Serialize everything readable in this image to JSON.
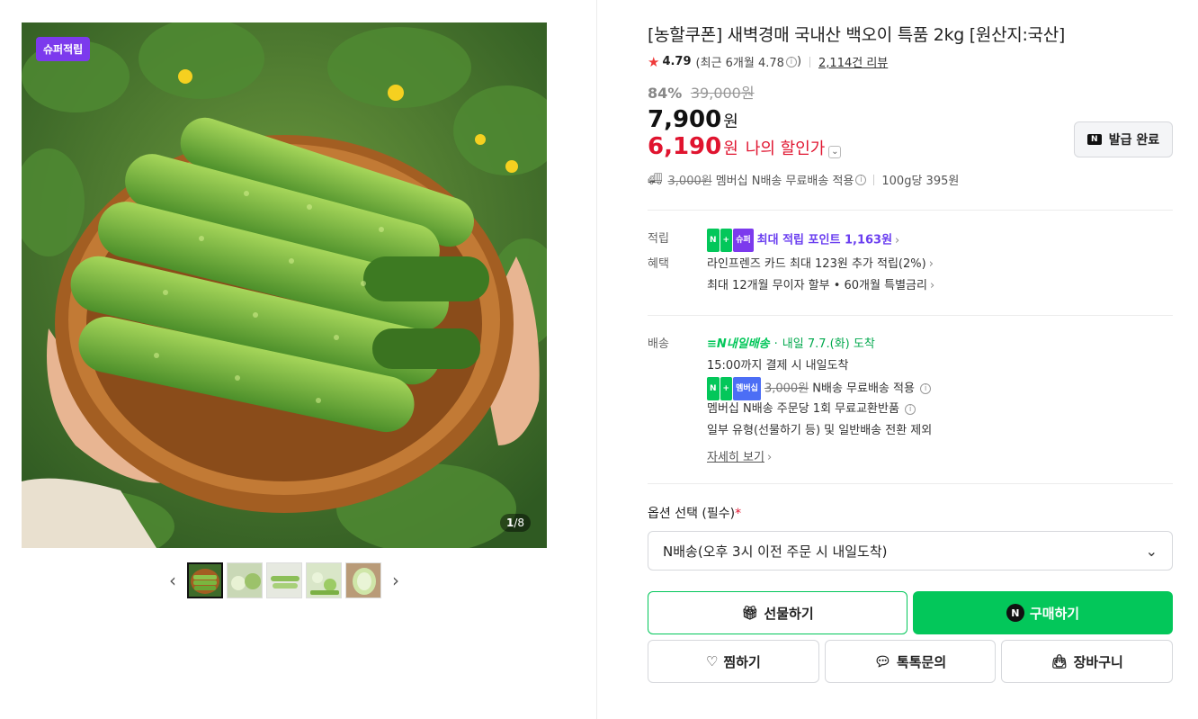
{
  "gallery": {
    "badge": "슈퍼적립",
    "counter_current": "1",
    "counter_total": "/8",
    "thumbnail_count": 5
  },
  "product": {
    "title": "[농할쿠폰] 새벽경매 국내산 백오이 특품 2kg [원산지:국산]",
    "rating": "4.79",
    "recent_rating": "(최근 6개월 4.78",
    "recent_rating_close": ")",
    "reviews": "2,114건 리뷰"
  },
  "price": {
    "discount_pct": "84%",
    "original": "39,000원",
    "current": "7,900",
    "current_unit": "원",
    "my_price": "6,190",
    "my_price_unit": "원",
    "my_price_label": "나의 할인가"
  },
  "coupon": {
    "label": "발급 완료"
  },
  "shipping_line": {
    "fee_strike": "3,000원",
    "text": "멤버십 N배송 무료배송 적용",
    "unit_price": "100g당 395원"
  },
  "benefits": {
    "points_label": "적립",
    "points_text": "최대 적립 포인트 1,163원",
    "benefit_label": "혜택",
    "benefit_lines": [
      "라인프렌즈 카드 최대 123원 추가 적립(2%)",
      "최대 12개월 무이자 할부 • 60개월 특별금리"
    ]
  },
  "delivery": {
    "label": "배송",
    "brand": "내일배송",
    "arrival": "내일 7.7.(화) 도착",
    "cutoff": "15:00까지 결제 시 내일도착",
    "free_fee_strike": "3,000원",
    "free_text": "N배송 무료배송 적용",
    "exchange": "멤버십 N배송 주문당 1회 무료교환반품",
    "exclusion": "일부 유형(선물하기 등) 및 일반배송 전환 제외",
    "more": "자세히 보기"
  },
  "option": {
    "label": "옵션 선택 (필수)",
    "required_mark": "*",
    "selected": "N배송(오후 3시 이전 주문 시 내일도착)"
  },
  "actions": {
    "gift": "선물하기",
    "buy": "구매하기",
    "wish": "찜하기",
    "talk": "톡톡문의",
    "cart": "장바구니"
  },
  "colors": {
    "naver_green": "#03c75a",
    "sale_red": "#e0142f",
    "super_purple": "#7c3aed"
  }
}
